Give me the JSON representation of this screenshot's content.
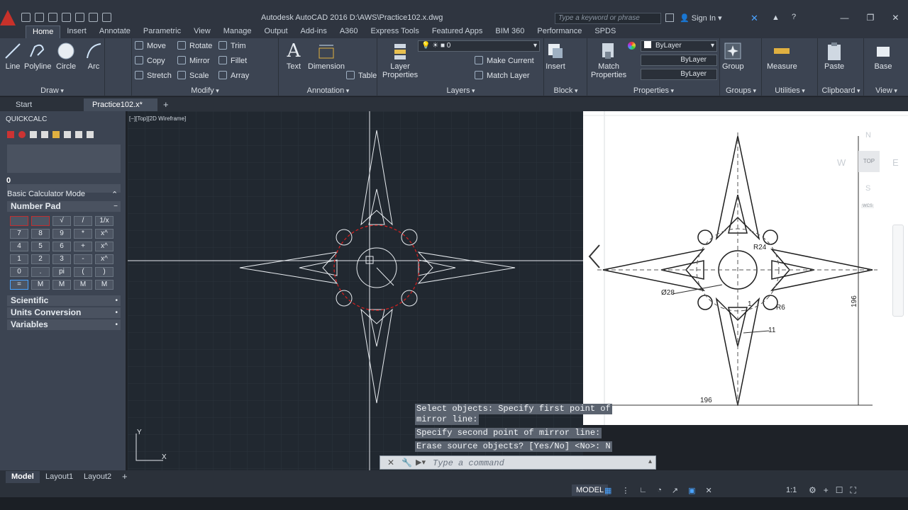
{
  "titlebar": {
    "app_title": "Autodesk AutoCAD 2016    D:\\AWS\\Practice102.x.dwg",
    "search_placeholder": "Type a keyword or phrase",
    "sign_in": "Sign In"
  },
  "ribbon_tabs": [
    "Home",
    "Insert",
    "Annotate",
    "Parametric",
    "View",
    "Manage",
    "Output",
    "Add-ins",
    "A360",
    "Express Tools",
    "Featured Apps",
    "BIM 360",
    "Performance",
    "SPDS"
  ],
  "active_tab": "Home",
  "ribbon": {
    "draw": {
      "title": "Draw",
      "line": "Line",
      "polyline": "Polyline",
      "circle": "Circle",
      "arc": "Arc"
    },
    "modify": {
      "title": "Modify",
      "move": "Move",
      "rotate": "Rotate",
      "trim": "Trim",
      "copy": "Copy",
      "mirror": "Mirror",
      "fillet": "Fillet",
      "stretch": "Stretch",
      "scale": "Scale",
      "array": "Array"
    },
    "annotation": {
      "title": "Annotation",
      "text": "Text",
      "dimension": "Dimension",
      "table": "Table"
    },
    "layers": {
      "title": "Layers",
      "layer_properties_1": "Layer",
      "layer_properties_2": "Properties",
      "current_layer": "0",
      "make_current": "Make Current",
      "match_layer": "Match Layer"
    },
    "block": {
      "title": "Block",
      "insert": "Insert"
    },
    "properties": {
      "title": "Properties",
      "match_1": "Match",
      "match_2": "Properties",
      "color": "ByLayer",
      "linetype": "ByLayer",
      "lineweight": "ByLayer"
    },
    "groups": {
      "title": "Groups",
      "group": "Group"
    },
    "utilities": {
      "title": "Utilities",
      "measure": "Measure"
    },
    "clipboard": {
      "title": "Clipboard",
      "paste": "Paste"
    },
    "view": {
      "title": "View",
      "base": "Base"
    }
  },
  "doc_tabs": {
    "start": "Start",
    "active": "Practice102.x*"
  },
  "quickcalc": {
    "title": "QUICKCALC",
    "display_value": "0",
    "mode": "Basic Calculator Mode",
    "number_pad": "Number Pad",
    "keys": [
      "",
      "",
      "√",
      "/",
      "1/x",
      "7",
      "8",
      "9",
      "*",
      "x^",
      "4",
      "5",
      "6",
      "+",
      "x^",
      "1",
      "2",
      "3",
      "-",
      "x^",
      "0",
      ".",
      "pi",
      "(",
      ")",
      "=",
      "M",
      "M",
      "M",
      "M"
    ],
    "sections": [
      "Scientific",
      "Units Conversion",
      "Variables"
    ]
  },
  "viewport": {
    "label": "[−][Top][2D Wireframe]",
    "ucs_x": "X",
    "ucs_y": "Y"
  },
  "reference": {
    "dim_r24": "R24",
    "dim_d28": "Ø28",
    "dim_r6": "R6",
    "dim_1": "1",
    "dim_11": "11",
    "dim_196_v": "196",
    "dim_196_h": "196",
    "viewcube": {
      "n": "N",
      "w": "W",
      "e": "E",
      "s": "S",
      "top": "TOP",
      "wcs": "WCS"
    }
  },
  "command_history": [
    "Select objects:  Specify first point of",
    "mirror line:",
    "Specify second point of mirror line:",
    "Erase source objects? [Yes/No] <No>: N"
  ],
  "command_input": {
    "placeholder": "Type a command"
  },
  "layout_tabs": [
    "Model",
    "Layout1",
    "Layout2"
  ],
  "status": {
    "model": "MODEL",
    "scale": "1:1"
  }
}
